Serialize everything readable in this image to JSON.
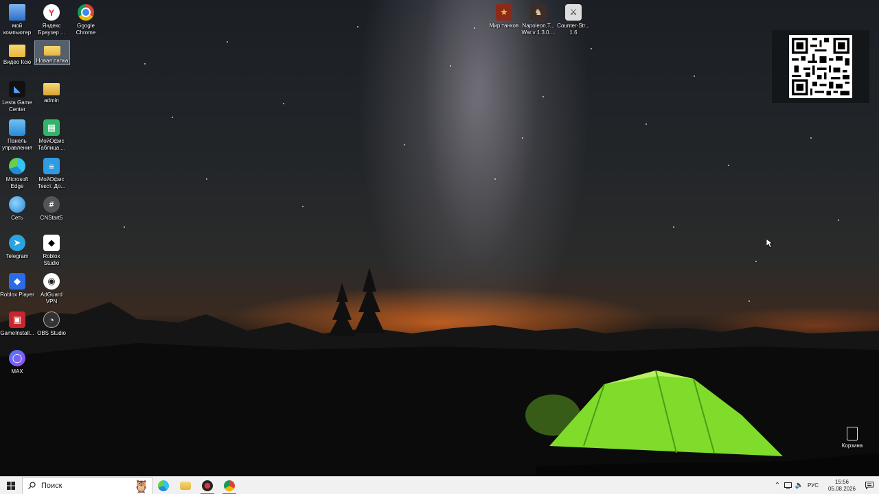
{
  "desktop": {
    "icons": [
      {
        "label": "мой\nкомпьютер",
        "icon": "computer-icon"
      },
      {
        "label": "Яндекс\nБраузер ...",
        "icon": "yandex-browser-icon"
      },
      {
        "label": "Google\nChrome",
        "icon": "chrome-icon"
      },
      {
        "label": "Видео Ксю",
        "icon": "folder-icon"
      },
      {
        "label": "Новая папка",
        "icon": "folder-icon",
        "selected": true
      },
      {
        "label": "Lesta Game\nCenter",
        "icon": "lesta-icon"
      },
      {
        "label": "admin",
        "icon": "user-folder-icon"
      },
      {
        "label": "Панель\nуправления",
        "icon": "control-panel-icon"
      },
      {
        "label": "МойОфис\nТаблица....",
        "icon": "myoffice-table-icon"
      },
      {
        "label": "Microsoft\nEdge",
        "icon": "edge-icon"
      },
      {
        "label": "МойОфис\nТекст. До...",
        "icon": "myoffice-text-icon"
      },
      {
        "label": "Сеть",
        "icon": "network-icon"
      },
      {
        "label": "CNStart5",
        "icon": "cnstart-icon"
      },
      {
        "label": "Telegram",
        "icon": "telegram-icon"
      },
      {
        "label": "Roblox\nStudio",
        "icon": "roblox-studio-icon"
      },
      {
        "label": "Roblox Player",
        "icon": "roblox-player-icon"
      },
      {
        "label": "AdGuard\nVPN",
        "icon": "adguard-icon"
      },
      {
        "label": "GameInstall...",
        "icon": "game-installer-icon"
      },
      {
        "label": "OBS Studio",
        "icon": "obs-icon"
      },
      {
        "label": "MAX",
        "icon": "max-icon"
      },
      {
        "label": "Мир танков",
        "icon": "tanks-icon"
      },
      {
        "label": "Napoleon.T...\nWar.v 1.3.0....",
        "icon": "napoleon-icon"
      },
      {
        "label": "Counter-Str...\n1.6",
        "icon": "counter-strike-icon"
      },
      {
        "label": "Корзина",
        "icon": "recycle-bin-icon"
      }
    ]
  },
  "taskbar": {
    "search_placeholder": "Поиск",
    "apps": [
      "edge-icon",
      "file-explorer-icon",
      "game-app-icon",
      "chrome-icon"
    ],
    "tray": {
      "language": "РУС",
      "time": "15:56",
      "date": "05.08.2026"
    }
  },
  "colors": {
    "taskbar_bg": "#f1f1f1",
    "tent_green": "#7fdc2a",
    "horizon_orange": "#e56b1f"
  }
}
